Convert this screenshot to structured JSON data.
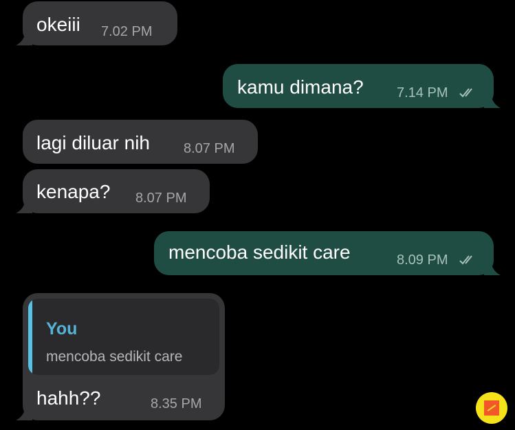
{
  "messages": [
    {
      "direction": "incoming",
      "text": "okeiii",
      "time": "7.02 PM"
    },
    {
      "direction": "outgoing",
      "text": "kamu dimana?",
      "time": "7.14 PM",
      "status": "read-double-check-icon"
    },
    {
      "direction": "incoming",
      "text": "lagi diluar nih",
      "time": "8.07 PM"
    },
    {
      "direction": "incoming",
      "text": "kenapa?",
      "time": "8.07 PM"
    },
    {
      "direction": "outgoing",
      "text": "mencoba sedikit care",
      "time": "8.09 PM",
      "status": "read-double-check-icon"
    },
    {
      "direction": "incoming",
      "text": "hahh??",
      "time": "8.35 PM",
      "reply_to": {
        "author": "You",
        "text": "mencoba sedikit care"
      }
    }
  ],
  "colors": {
    "background": "#000000",
    "incoming_bubble": "#363638",
    "outgoing_bubble": "#1f4d43",
    "quote_accent": "#56c3e6"
  },
  "badge": {
    "icon": "app-logo-icon"
  }
}
